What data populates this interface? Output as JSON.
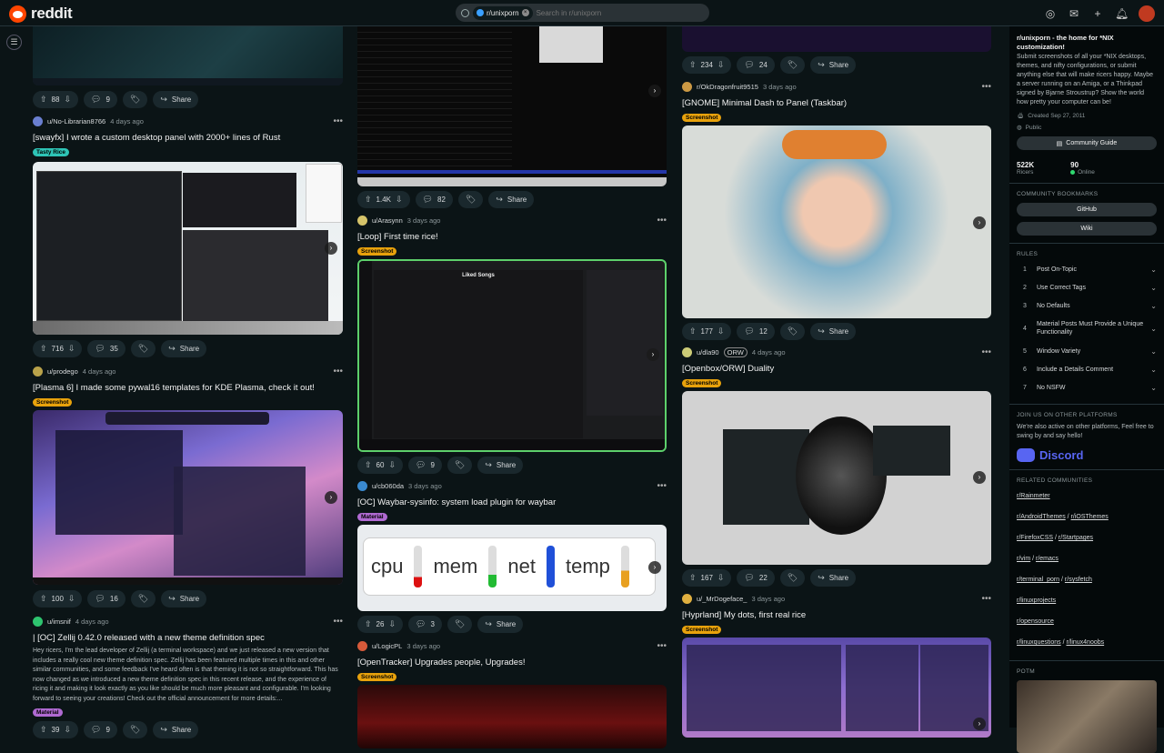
{
  "header": {
    "brand": "reddit",
    "search_chip": "r/unixporn",
    "search_placeholder": "Search in r/unixporn"
  },
  "col1": {
    "post0_actions": {
      "votes": "88",
      "comments": "9",
      "share": "Share"
    },
    "post1": {
      "user": "u/No-Librarian8766",
      "time": "4 days ago",
      "title": "[swayfx] I wrote a custom desktop panel with 2000+ lines of Rust",
      "flair": "Tasty Rice",
      "votes": "716",
      "comments": "35",
      "share": "Share"
    },
    "post2": {
      "user": "u/prodego",
      "time": "4 days ago",
      "title": "[Plasma 6] I made some pywal16 templates for KDE Plasma, check it out!",
      "flair": "Screenshot",
      "votes": "100",
      "comments": "16",
      "share": "Share"
    },
    "post3": {
      "user": "u/imsnif",
      "time": "4 days ago",
      "title": "| [OC] Zellij 0.42.0 released with a new theme definition spec",
      "body": "Hey ricers, I'm the lead developer of Zellij (a terminal workspace) and we just released a new version that includes a really cool new theme definition spec. Zellij has been featured multiple times in this and other similar communities, and some feedback I've heard often is that theming it is not so straightforward. This has now changed as we introduced a new theme definition spec in this recent release, and the experience of ricing it and making it look exactly as you like should be much more pleasant and configurable. I'm looking forward to seeing your creations! Check out the official announcement for more details:...",
      "flair": "Material",
      "votes": "39",
      "comments": "9",
      "share": "Share"
    }
  },
  "col2": {
    "post0_actions": {
      "votes": "1.4K",
      "comments": "82",
      "share": "Share"
    },
    "post1": {
      "user": "u/Arasynn",
      "time": "3 days ago",
      "title": "[Loop] First time rice!",
      "flair": "Screenshot",
      "votes": "60",
      "comments": "9",
      "share": "Share",
      "app_header": "Liked Songs"
    },
    "post2": {
      "user": "u/cb060da",
      "time": "3 days ago",
      "title": "[OC] Waybar-sysinfo: system load plugin for waybar",
      "flair": "Material",
      "votes": "26",
      "comments": "3",
      "share": "Share",
      "labels": [
        "cpu",
        "mem",
        "net",
        "temp"
      ]
    },
    "post3": {
      "user": "u/LogicPL",
      "time": "3 days ago",
      "title": "[OpenTracker] Upgrades people, Upgrades!",
      "flair": "Screenshot"
    }
  },
  "col3": {
    "post0_actions": {
      "votes": "234",
      "comments": "24",
      "share": "Share"
    },
    "post1": {
      "user": "r/OkDragonfruit9515",
      "time": "3 days ago",
      "title": "[GNOME] Minimal Dash to Panel (Taskbar)",
      "flair": "Screenshot",
      "votes": "177",
      "comments": "12",
      "share": "Share"
    },
    "post2": {
      "user": "u/dla90",
      "badge": "ORW",
      "time": "4 days ago",
      "title": "[Openbox/ORW] Duality",
      "flair": "Screenshot",
      "votes": "167",
      "comments": "22",
      "share": "Share"
    },
    "post3": {
      "user": "u/_MrDogeface_",
      "time": "3 days ago",
      "title": "[Hyprland] My dots, first real rice",
      "flair": "Screenshot"
    }
  },
  "sidebar": {
    "title": "r/unixporn - the home for *NIX customization!",
    "desc": "Submit screenshots of all your *NIX desktops, themes, and nifty configurations, or submit anything else that will make ricers happy. Maybe a server running on an Amiga, or a Thinkpad signed by Bjarne Stroustrup? Show the world how pretty your computer can be!",
    "created": "Created Sep 27, 2011",
    "visibility": "Public",
    "guide_btn": "Community Guide",
    "members": "522K",
    "members_label": "Ricers",
    "online": "90",
    "online_label": "Online",
    "bookmarks_heading": "COMMUNITY BOOKMARKS",
    "bookmarks": [
      "GitHub",
      "Wiki"
    ],
    "rules_heading": "RULES",
    "rules": [
      {
        "n": "1",
        "t": "Post On-Topic"
      },
      {
        "n": "2",
        "t": "Use Correct Tags"
      },
      {
        "n": "3",
        "t": "No Defaults"
      },
      {
        "n": "4",
        "t": "Material Posts Must Provide a Unique Functionality"
      },
      {
        "n": "5",
        "t": "Window Variety"
      },
      {
        "n": "6",
        "t": "Include a Details Comment"
      },
      {
        "n": "7",
        "t": "No NSFW"
      }
    ],
    "platforms_heading": "JOIN US ON OTHER PLATFORMS",
    "platforms_desc": "We're also active on other platforms, Feel free to swing by and say hello!",
    "discord": "Discord",
    "related_heading": "RELATED COMMUNITIES",
    "related": [
      [
        "r/Rainmeter"
      ],
      [
        "r/AndroidThemes",
        "r/iOSThemes"
      ],
      [
        "r/FirefoxCSS",
        "r/Startpages"
      ],
      [
        "r/vim",
        "r/emacs"
      ],
      [
        "r/terminal_porn",
        "r/sysfetch"
      ],
      [
        "r/linuxprojects"
      ],
      [
        "r/opensource"
      ],
      [
        "r/linuxquestions",
        "r/linux4noobs"
      ]
    ],
    "potm_heading": "POTM"
  }
}
